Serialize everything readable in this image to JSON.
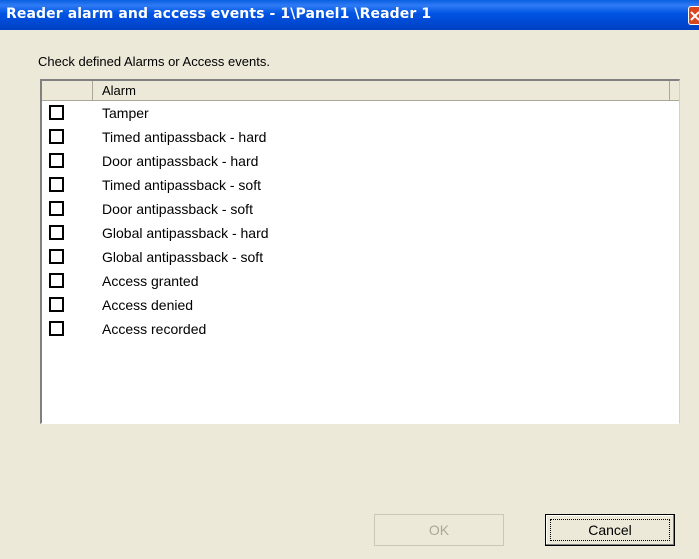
{
  "window": {
    "title": "Reader alarm and access events - 1\\Panel1 \\Reader 1",
    "close_icon": "close-icon"
  },
  "instruction": "Check defined Alarms or Access events.",
  "list": {
    "column_header": "Alarm",
    "items": [
      {
        "label": "Tamper",
        "checked": false
      },
      {
        "label": "Timed antipassback - hard",
        "checked": false
      },
      {
        "label": "Door antipassback - hard",
        "checked": false
      },
      {
        "label": "Timed antipassback - soft",
        "checked": false
      },
      {
        "label": "Door antipassback - soft",
        "checked": false
      },
      {
        "label": "Global antipassback - hard",
        "checked": false
      },
      {
        "label": "Global antipassback - soft",
        "checked": false
      },
      {
        "label": "Access granted",
        "checked": false
      },
      {
        "label": "Access denied",
        "checked": false
      },
      {
        "label": "Access recorded",
        "checked": false
      }
    ]
  },
  "buttons": {
    "ok_label": "OK",
    "ok_enabled": false,
    "cancel_label": "Cancel"
  },
  "colors": {
    "titlebar": "#0054e3",
    "dialog_bg": "#ece9d8",
    "close_button": "#d9451c"
  }
}
